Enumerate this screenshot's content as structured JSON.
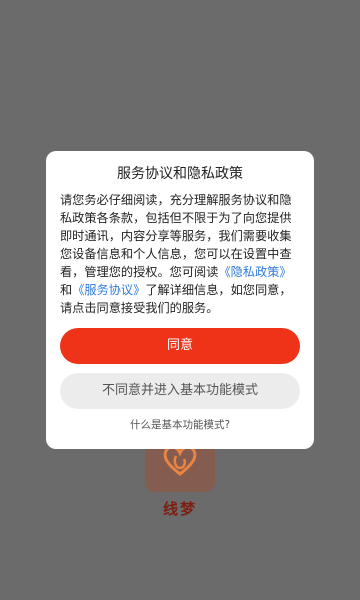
{
  "app": {
    "name": "线梦"
  },
  "dialog": {
    "title": "服务协议和隐私政策",
    "body_intro": "请您务必仔细阅读，充分理解服务协议和隐私政策各条款，包括但不限于为了向您提供即时通讯，内容分享等服务，我们需要收集您设备信息和个人信息，您可以在设置中查看，管理您的授权。您可阅读",
    "privacy_link": "《隐私政策》",
    "and_text": "和",
    "service_link": "《服务协议》",
    "body_outro": "了解详细信息，如您同意，请点击同意接受我们的服务。",
    "agree_button": "同意",
    "basic_mode_button": "不同意并进入基本功能模式",
    "basic_mode_help": "什么是基本功能模式?"
  },
  "colors": {
    "accent": "#ee3319",
    "link": "#2f7bd9",
    "overlay": "#6b6b6b"
  }
}
